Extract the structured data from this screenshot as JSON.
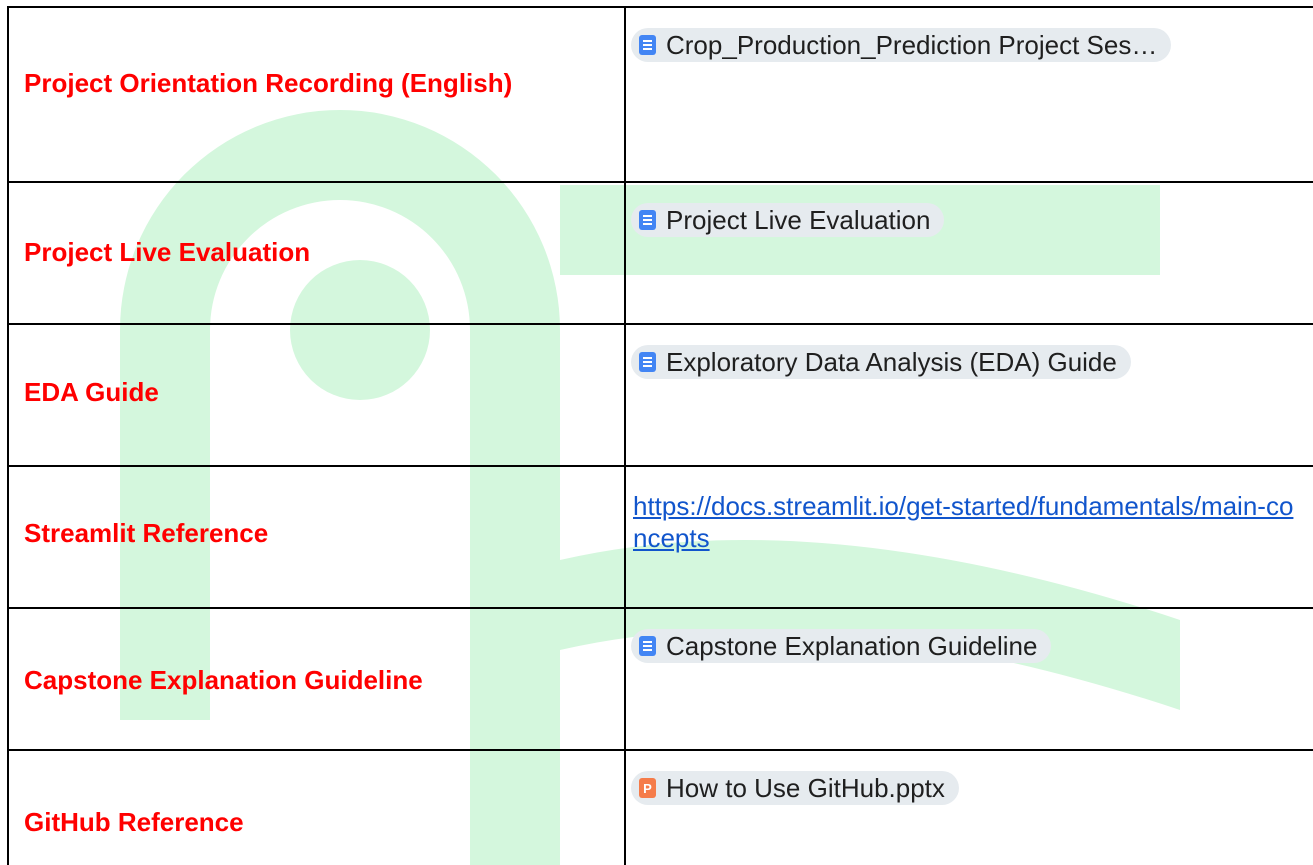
{
  "colors": {
    "label_red": "#ff0000",
    "watermark_green": "#d4f7dd",
    "chip_bg": "#e6ebef",
    "doc_icon_blue": "#4285f4",
    "ppt_icon_orange": "#f57c4a",
    "link_blue": "#1155cc",
    "border": "#000000"
  },
  "rows": [
    {
      "label": "Project Orientation Recording (English)",
      "resource_type": "doc-chip",
      "resource": "Crop_Production_Prediction Project Ses…",
      "icon": "document-icon"
    },
    {
      "label": "Project Live Evaluation",
      "resource_type": "doc-chip",
      "resource": "Project Live Evaluation",
      "icon": "document-icon"
    },
    {
      "label": "EDA Guide",
      "resource_type": "doc-chip",
      "resource": "Exploratory Data Analysis (EDA) Guide",
      "icon": "document-icon"
    },
    {
      "label": "Streamlit Reference",
      "resource_type": "link",
      "resource": "https://docs.streamlit.io/get-started/fundamentals/main-concepts"
    },
    {
      "label": "Capstone Explanation Guideline",
      "resource_type": "doc-chip",
      "resource": "Capstone Explanation Guideline",
      "icon": "document-icon"
    },
    {
      "label": "GitHub Reference",
      "resource_type": "ppt-chip",
      "resource": "How to Use GitHub.pptx",
      "icon": "presentation-icon",
      "icon_letter": "P"
    }
  ]
}
